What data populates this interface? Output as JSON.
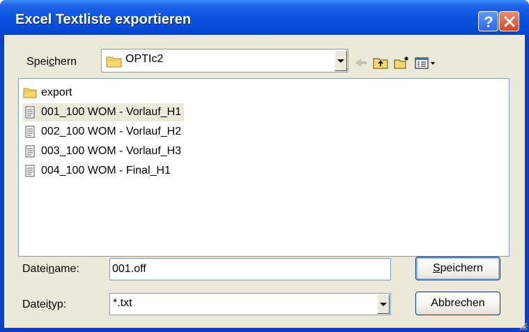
{
  "window": {
    "title": "Excel Textliste exportieren"
  },
  "toolbar": {
    "save_in_label_pre": "Spei",
    "save_in_label_access": "c",
    "save_in_label_post": "hern",
    "location": "OPTIc2"
  },
  "files": [
    {
      "name": "export",
      "kind": "folder"
    },
    {
      "name": "001_100 WOM - Vorlauf_H1",
      "kind": "text-file",
      "selected": true
    },
    {
      "name": "002_100 WOM - Vorlauf_H2",
      "kind": "text-file"
    },
    {
      "name": "003_100 WOM - Vorlauf_H3",
      "kind": "text-file"
    },
    {
      "name": "004_100 WOM - Final_H1",
      "kind": "text-file"
    }
  ],
  "filename": {
    "label_pre": "Datei",
    "label_access": "n",
    "label_post": "ame:",
    "value": "001.off"
  },
  "filetype": {
    "label_pre": "Datei",
    "label_access": "t",
    "label_post": "yp:",
    "value": "*.txt"
  },
  "buttons": {
    "save_access": "S",
    "save_rest": "peichern",
    "cancel": "Abbrechen"
  },
  "colors": {
    "title_bar": "#0a52e0",
    "dialog_face": "#ece9d8",
    "field_border": "#7f9db9",
    "close_button": "#d84521"
  }
}
